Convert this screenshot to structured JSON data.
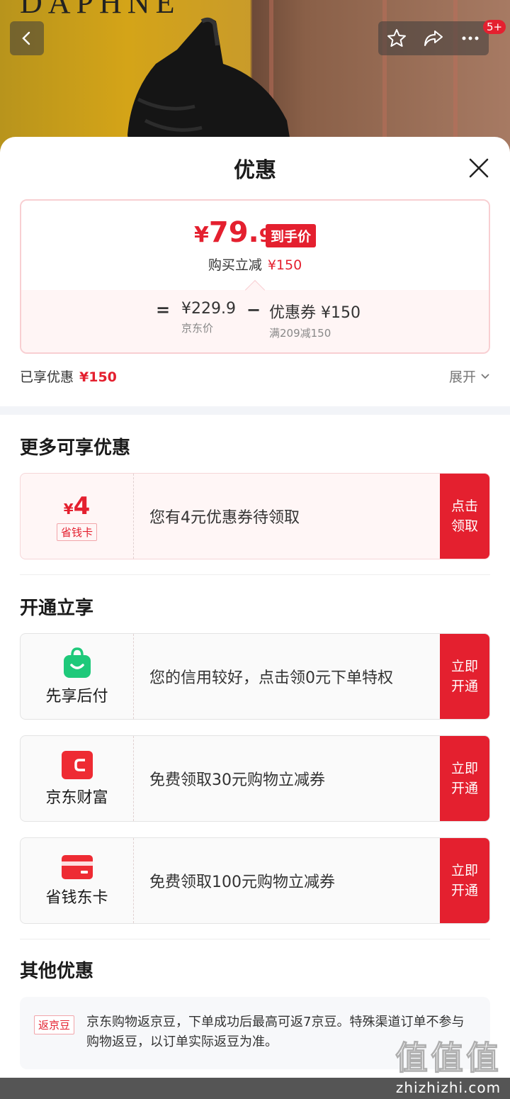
{
  "header": {
    "brand": "DAPHNE",
    "more_badge": "5+",
    "icons": [
      "back-icon",
      "star-icon",
      "share-icon",
      "more-icon"
    ]
  },
  "sheet": {
    "title": "优惠",
    "price": {
      "currency": "¥",
      "integer": "79.",
      "decimal": "9",
      "tag": "到手价",
      "reduce_label": "购买立减",
      "reduce_amount": "¥150",
      "equals": "=",
      "minus": "−",
      "jd_price": "¥229.9",
      "jd_price_label": "京东价",
      "coupon_value": "优惠券 ¥150",
      "coupon_rule": "满209减150"
    },
    "enjoyed_label": "已享优惠",
    "enjoyed_amount": "¥150",
    "expand_label": "展开"
  },
  "more_offers": {
    "title": "更多可享优惠",
    "card": {
      "currency": "¥",
      "amount": "4",
      "tag": "省钱卡",
      "desc": "您有4元优惠券待领取",
      "cta_line1": "点击",
      "cta_line2": "领取"
    }
  },
  "open_enjoy": {
    "title": "开通立享",
    "cards": [
      {
        "label": "先享后付",
        "icon": "shopping-bag-icon",
        "desc": "您的信用较好，点击领0元下单特权",
        "cta_line1": "立即",
        "cta_line2": "开通"
      },
      {
        "label": "京东财富",
        "icon": "wallet-icon",
        "desc": "免费领取30元购物立减券",
        "cta_line1": "立即",
        "cta_line2": "开通"
      },
      {
        "label": "省钱东卡",
        "icon": "card-icon",
        "desc": "免费领取100元购物立减券",
        "cta_line1": "立即",
        "cta_line2": "开通"
      }
    ]
  },
  "other_offers": {
    "title": "其他优惠",
    "tag": "返京豆",
    "text": "京东购物返京豆，下单成功后最高可返7京豆。特殊渠道订单不参与购物返豆，以订单实际返豆为准。"
  },
  "watermark": {
    "big": "值值值",
    "small": "zhizhizhi.com"
  },
  "colors": {
    "accent": "#e4202f",
    "green": "#1ec97a",
    "pink_border": "#f8cfd2"
  }
}
